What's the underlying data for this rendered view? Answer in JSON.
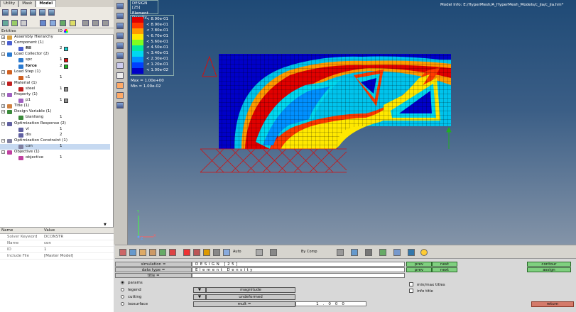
{
  "tabs": [
    "Utility",
    "Mask",
    "Model"
  ],
  "entities_header": {
    "label": "Entities",
    "id_label": "ID"
  },
  "tree": [
    {
      "type": "group",
      "label": "Assembly Hierarchy",
      "expander": "+",
      "icon": "assembly-icon",
      "id": "",
      "color": ""
    },
    {
      "type": "group",
      "label": "Component (1)",
      "expander": "−",
      "icon": "component-icon",
      "id": "",
      "color": ""
    },
    {
      "type": "child",
      "label": "fill",
      "bold": true,
      "icon": "component-icon",
      "id": "2",
      "color": "#19d1d1"
    },
    {
      "type": "group",
      "label": "Load Collector (2)",
      "expander": "−",
      "icon": "load-collector-icon",
      "id": "",
      "color": ""
    },
    {
      "type": "child",
      "label": "spc",
      "bold": false,
      "icon": "load-collector-icon",
      "id": "1",
      "color": "#e01010"
    },
    {
      "type": "child",
      "label": "force",
      "bold": true,
      "icon": "load-collector-icon",
      "id": "2",
      "color": "#20b020"
    },
    {
      "type": "group",
      "label": "Load Step (1)",
      "expander": "−",
      "icon": "load-step-icon",
      "id": "",
      "color": ""
    },
    {
      "type": "child",
      "label": "c1",
      "bold": false,
      "icon": "load-step-icon",
      "id": "1",
      "color": ""
    },
    {
      "type": "group",
      "label": "Material (1)",
      "expander": "−",
      "icon": "material-icon",
      "id": "",
      "color": ""
    },
    {
      "type": "child",
      "label": "steel",
      "bold": false,
      "icon": "material-icon",
      "id": "1",
      "color": "#909090"
    },
    {
      "type": "group",
      "label": "Property (1)",
      "expander": "−",
      "icon": "property-icon",
      "id": "",
      "color": ""
    },
    {
      "type": "child",
      "label": "p1",
      "bold": false,
      "icon": "property-icon",
      "id": "1",
      "color": "#909090"
    },
    {
      "type": "group",
      "label": "Title (1)",
      "expander": "+",
      "icon": "title-icon",
      "id": "",
      "color": ""
    },
    {
      "type": "group",
      "label": "Design Variable (1)",
      "expander": "−",
      "icon": "design-variable-icon",
      "id": "",
      "color": ""
    },
    {
      "type": "child",
      "label": "bianliang",
      "bold": false,
      "icon": "design-variable-icon",
      "id": "1",
      "color": ""
    },
    {
      "type": "group",
      "label": "Optimization Response (2)",
      "expander": "−",
      "icon": "opti-response-icon",
      "id": "",
      "color": ""
    },
    {
      "type": "child",
      "label": "vl",
      "bold": false,
      "icon": "opti-response-icon",
      "id": "1",
      "color": ""
    },
    {
      "type": "child",
      "label": "dis",
      "bold": false,
      "icon": "opti-response-icon",
      "id": "2",
      "color": ""
    },
    {
      "type": "group",
      "label": "Optimization Constraint (1)",
      "expander": "−",
      "icon": "opti-constraint-icon",
      "id": "",
      "color": ""
    },
    {
      "type": "child",
      "label": "con",
      "bold": false,
      "icon": "opti-constraint-icon",
      "id": "1",
      "color": "",
      "selected": true
    },
    {
      "type": "group",
      "label": "Objective (1)",
      "expander": "−",
      "icon": "objective-icon",
      "id": "",
      "color": ""
    },
    {
      "type": "child",
      "label": "objective",
      "bold": false,
      "icon": "objective-icon",
      "id": "1",
      "color": ""
    }
  ],
  "props": {
    "name_col": "Name",
    "value_col": "Value",
    "rows": [
      {
        "k": "Solver Keyword",
        "v": "DCONSTR"
      },
      {
        "k": "Name",
        "v": "con"
      },
      {
        "k": "ID",
        "v": "1"
      },
      {
        "k": "Include File",
        "v": "[Master Model]"
      }
    ]
  },
  "viewport": {
    "design_label": "DESIGN [25]",
    "result_label": "Element Density",
    "model_info": "Model Info: E:/HyperMesh/A_HyperMesh_Models/c_jia/c_jia.hm*",
    "legend": [
      {
        "color": "#e00000",
        "label": "< 8.90e-01"
      },
      {
        "color": "#ff3a00",
        "label": "< 8.90e-01"
      },
      {
        "color": "#ff9a00",
        "label": "< 7.80e-01"
      },
      {
        "color": "#ffe800",
        "label": "< 6.70e-01"
      },
      {
        "color": "#7fff20",
        "label": "< 5.60e-01"
      },
      {
        "color": "#00e8a0",
        "label": "< 4.50e-01"
      },
      {
        "color": "#00d8f0",
        "label": "< 3.40e-01"
      },
      {
        "color": "#0090ff",
        "label": "< 2.30e-01"
      },
      {
        "color": "#0040ff",
        "label": "< 1.20e-01"
      },
      {
        "color": "#0000c8",
        "label": "< 1.00e-02"
      }
    ],
    "max_label": "Max = 1.00e+00",
    "min_label": "Min = 1.00e-02",
    "axes": {
      "y": "Y",
      "x": "X",
      "z": "Z"
    }
  },
  "bottom_toolbar": {
    "auto_label": "Auto",
    "bycomp_label": "By Comp"
  },
  "panel": {
    "simulation_label": "simulation =",
    "simulation_value": "DESIGN [25]",
    "datatype_label": "data type =",
    "datatype_value": "Element Density",
    "title_label": "title =",
    "prev_label": "prev",
    "next_label": "next",
    "contour_label": "contour",
    "assign_label": "assign",
    "radios": [
      "params",
      "legend",
      "cutting",
      "isosurface"
    ],
    "magnitude_label": "magnitude",
    "undeformed_label": "undeformed",
    "mult_label": "mult =",
    "mult_value": "1.000",
    "minmax_label": "min/max titles",
    "infotitle_label": "info title",
    "return_label": "return"
  }
}
